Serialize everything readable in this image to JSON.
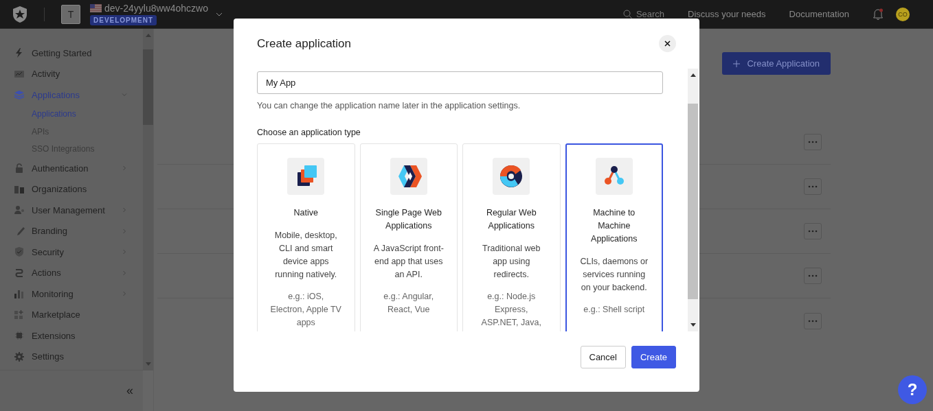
{
  "topbar": {
    "tenant_initial": "T",
    "tenant_name": "dev-24yylu8ww4ohczwo",
    "environment_badge": "DEVELOPMENT",
    "search_label": "Search",
    "links": [
      "Discuss your needs",
      "Documentation"
    ],
    "notifications_unread": true,
    "avatar_initials": "CO"
  },
  "sidebar": {
    "items": [
      {
        "label": "Getting Started",
        "selected": false,
        "expandable": false
      },
      {
        "label": "Activity",
        "selected": false,
        "expandable": false
      },
      {
        "label": "Applications",
        "selected": true,
        "expandable": true,
        "expanded": true,
        "children": [
          {
            "label": "Applications",
            "selected": true
          },
          {
            "label": "APIs",
            "selected": false
          },
          {
            "label": "SSO Integrations",
            "selected": false
          }
        ]
      },
      {
        "label": "Authentication",
        "selected": false,
        "expandable": true,
        "expanded": false
      },
      {
        "label": "Organizations",
        "selected": false,
        "expandable": false
      },
      {
        "label": "User Management",
        "selected": false,
        "expandable": true,
        "expanded": false
      },
      {
        "label": "Branding",
        "selected": false,
        "expandable": true,
        "expanded": false
      },
      {
        "label": "Security",
        "selected": false,
        "expandable": true,
        "expanded": false
      },
      {
        "label": "Actions",
        "selected": false,
        "expandable": true,
        "expanded": false
      },
      {
        "label": "Monitoring",
        "selected": false,
        "expandable": true,
        "expanded": false
      },
      {
        "label": "Marketplace",
        "selected": false,
        "expandable": false
      },
      {
        "label": "Extensions",
        "selected": false,
        "expandable": false
      },
      {
        "label": "Settings",
        "selected": false,
        "expandable": false
      }
    ],
    "collapse_label": "«"
  },
  "main": {
    "create_button": "Create Application"
  },
  "modal": {
    "title": "Create application",
    "name_field": {
      "value": "My App"
    },
    "name_hint": "You can change the application name later in the application settings.",
    "type_heading": "Choose an application type",
    "types": [
      {
        "title": "Native",
        "description": "Mobile, desktop, CLI and smart device apps running natively.",
        "examples": "e.g.: iOS, Electron, Apple TV apps",
        "selected": false
      },
      {
        "title": "Single Page Web Applications",
        "description": "A JavaScript front-end app that uses an API.",
        "examples": "e.g.: Angular, React, Vue",
        "selected": false
      },
      {
        "title": "Regular Web Applications",
        "description": "Traditional web app using redirects.",
        "examples": "e.g.: Node.js Express, ASP.NET, Java,",
        "selected": false
      },
      {
        "title": "Machine to Machine Applications",
        "description": "CLIs, daemons or services running on your backend.",
        "examples": "e.g.: Shell script",
        "selected": true
      }
    ],
    "buttons": [
      {
        "label": "Cancel",
        "kind": "secondary"
      },
      {
        "label": "Create",
        "kind": "primary"
      }
    ]
  },
  "help_button": "?"
}
